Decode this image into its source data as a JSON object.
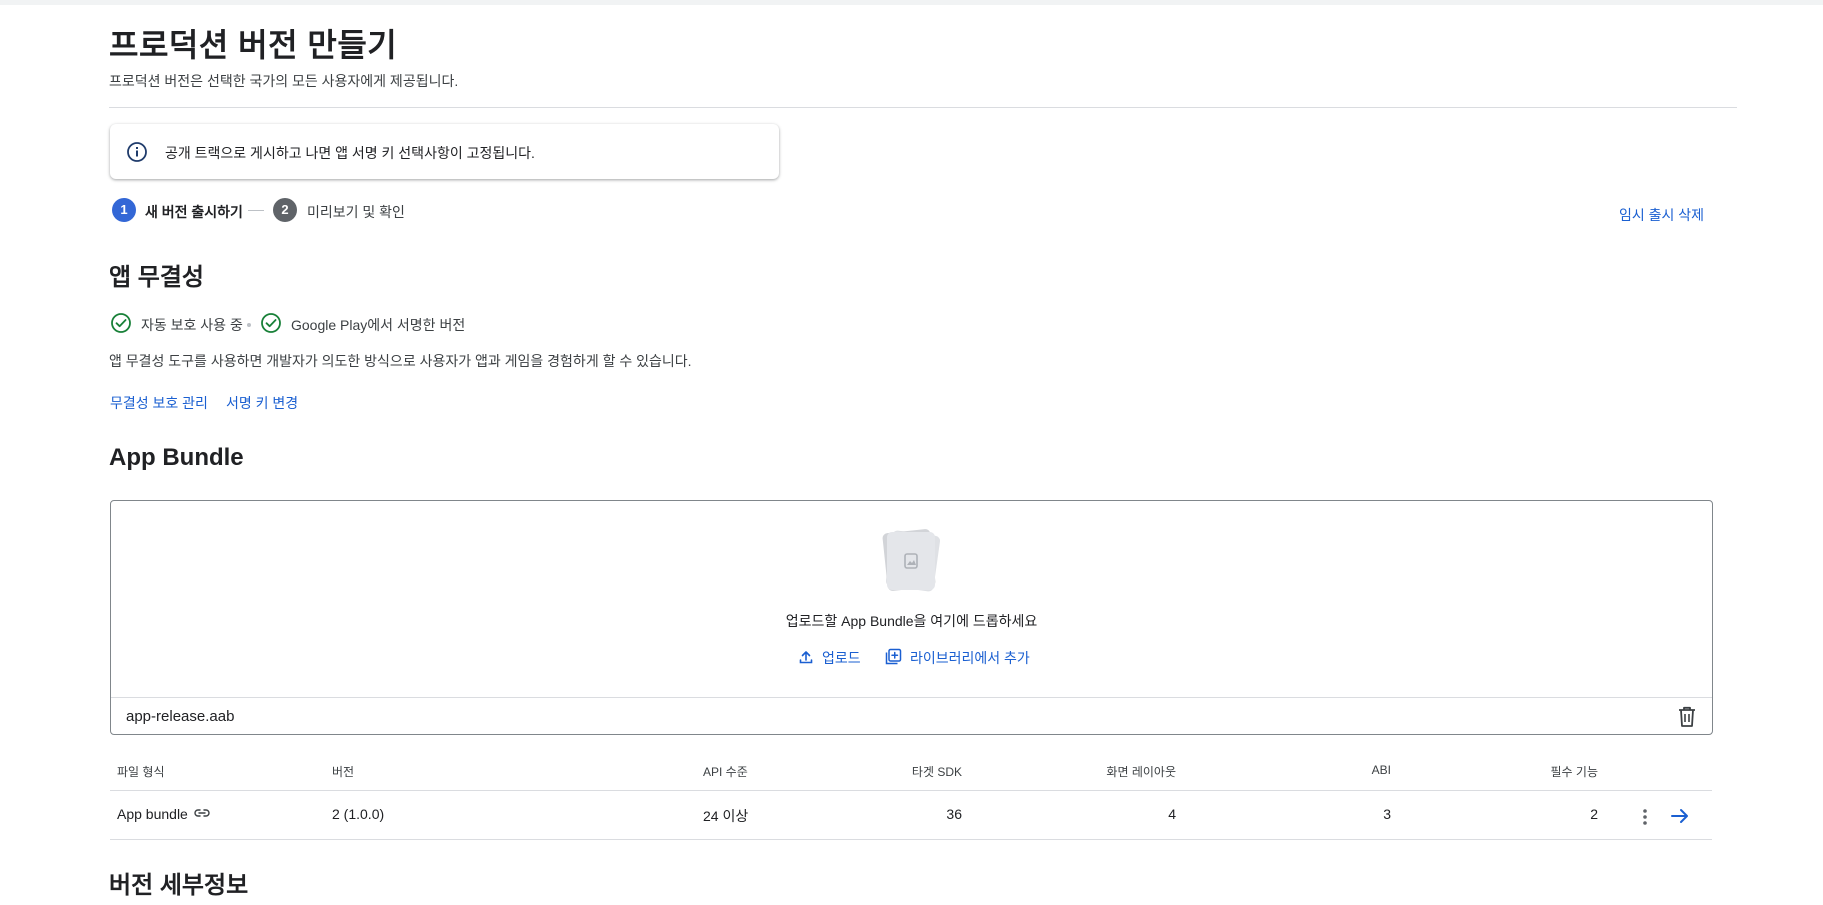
{
  "header": {
    "title": "프로덕션 버전 만들기",
    "subtitle": "프로덕션 버전은 선택한 국가의 모든 사용자에게 제공됩니다."
  },
  "banner": {
    "icon": "info-icon",
    "text": "공개 트랙으로 게시하고 나면 앱 서명 키 선택사항이 고정됩니다."
  },
  "stepper": {
    "steps": [
      {
        "number": "1",
        "label": "새 버전 출시하기",
        "active": true
      },
      {
        "number": "2",
        "label": "미리보기 및 확인",
        "active": false
      }
    ],
    "delete_draft": "임시 출시 삭제"
  },
  "integrity": {
    "heading": "앱 무결성",
    "statuses": [
      {
        "icon": "check-circle-icon",
        "label": "자동 보호 사용 중"
      },
      {
        "icon": "check-circle-icon",
        "label": "Google Play에서 서명한 버전"
      }
    ],
    "description": "앱 무결성 도구를 사용하면 개발자가 의도한 방식으로 사용자가 앱과 게임을 경험하게 할 수 있습니다.",
    "links": [
      "무결성 보호 관리",
      "서명 키 변경"
    ]
  },
  "bundle": {
    "heading": "App Bundle",
    "drop_text": "업로드할 App Bundle을 여기에 드롭하세요",
    "upload_label": "업로드",
    "library_label": "라이브러리에서 추가",
    "file_name": "app-release.aab"
  },
  "table": {
    "headers": [
      "파일 형식",
      "버전",
      "API 수준",
      "타겟 SDK",
      "화면 레이아웃",
      "ABI",
      "필수 기능"
    ],
    "rows": [
      {
        "type": "App bundle",
        "version": "2 (1.0.0)",
        "api": "24 이상",
        "target_sdk": "36",
        "layouts": "4",
        "abi": "3",
        "features": "2"
      }
    ]
  },
  "details": {
    "heading": "버전 세부정보"
  },
  "colors": {
    "accent": "#1a5fd1",
    "step_active": "#3367d6",
    "step_inactive": "#5f6368",
    "success": "#188038"
  }
}
